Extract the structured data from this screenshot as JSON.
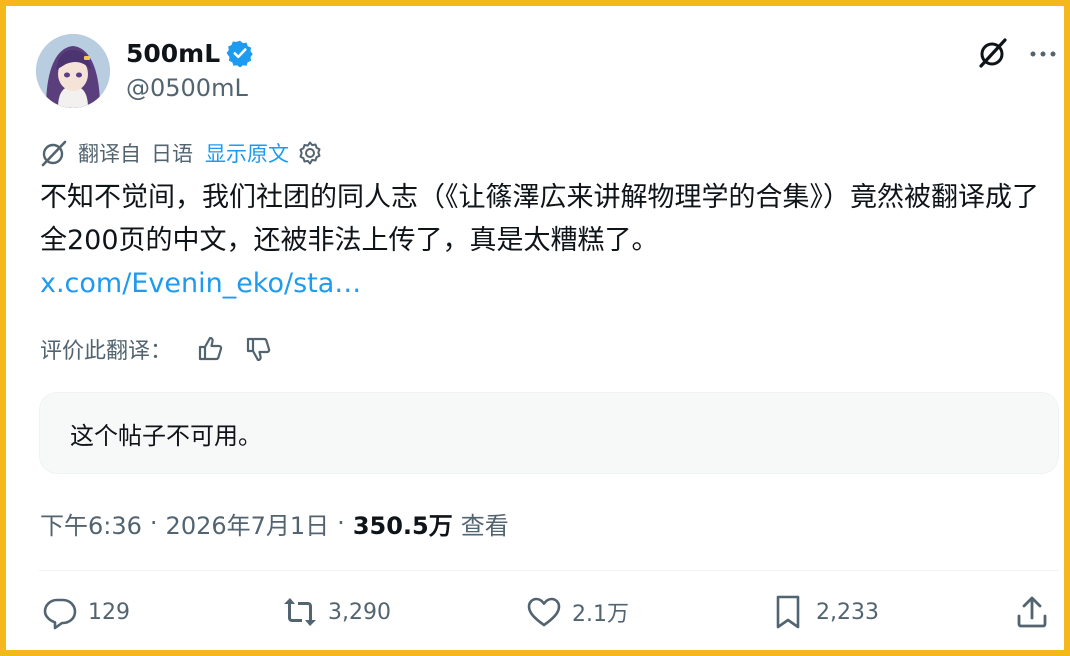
{
  "author": {
    "display_name": "500mL",
    "handle": "@0500mL",
    "verified": true,
    "avatar": "anime-avatar"
  },
  "translation": {
    "label": "翻译自",
    "language": "日语",
    "show_original": "显示原文"
  },
  "tweet": {
    "text": "不知不觉间，我们社团的同人志（《让篠澤広来讲解物理学的合集》）竟然被翻译成了全200页的中文，还被非法上传了，真是太糟糕了。",
    "link": "x.com/Evenin_eko/sta…"
  },
  "rating": {
    "label": "评价此翻译："
  },
  "quoted": {
    "unavailable_text": "这个帖子不可用。"
  },
  "meta": {
    "time": "下午6:36",
    "date": "2026年7月1日",
    "views_count": "350.5万",
    "views_label": "查看",
    "separator": "·"
  },
  "actions": {
    "replies": "129",
    "reposts": "3,290",
    "likes": "2.1万",
    "bookmarks": "2,233"
  },
  "colors": {
    "accent": "#1d9bf0",
    "frame": "#f4b81c",
    "secondary_text": "#536471"
  }
}
